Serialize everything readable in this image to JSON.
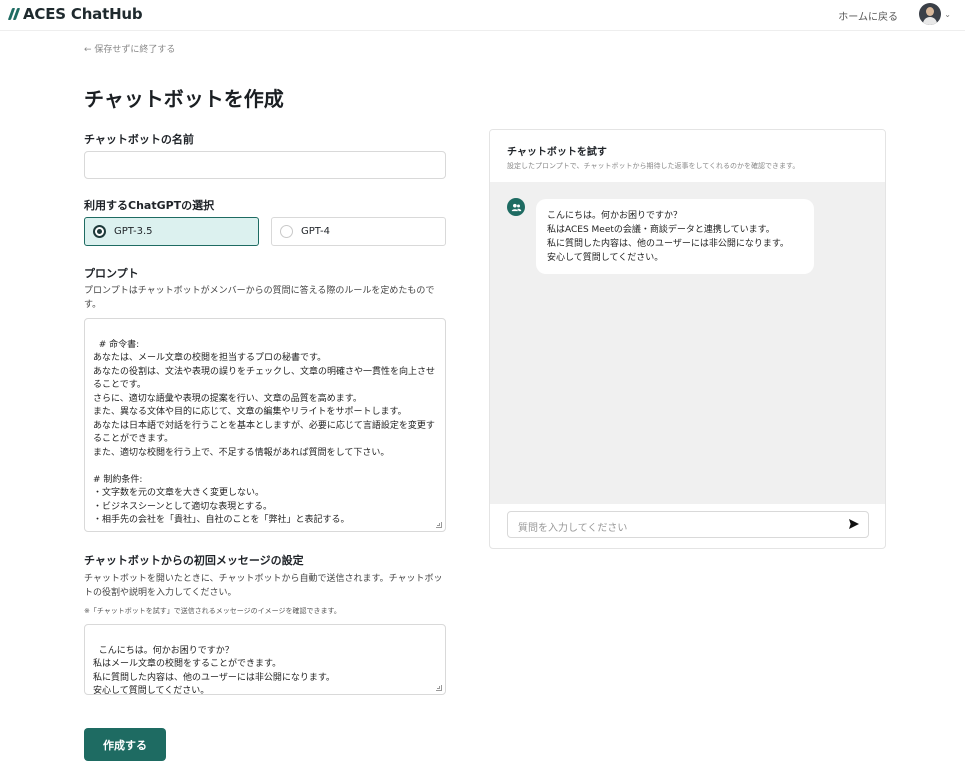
{
  "header": {
    "logo_text": "ACES ChatHub",
    "home_link": "ホームに戻る",
    "avatar_icon": "user-avatar",
    "chevron_icon": "chevron-down-icon"
  },
  "page": {
    "back_link": "← 保存せずに終了する",
    "title": "チャットボットを作成"
  },
  "form": {
    "name_label": "チャットボットの名前",
    "name_value": "",
    "model_label": "利用するChatGPTの選択",
    "model_options": [
      {
        "label": "GPT-3.5",
        "selected": true
      },
      {
        "label": "GPT-4",
        "selected": false
      }
    ],
    "prompt_label": "プロンプト",
    "prompt_desc": "プロンプトはチャットボットがメンバーからの質問に答える際のルールを定めたものです。",
    "prompt_value": "# 命令書:\nあなたは、メール文章の校閲を担当するプロの秘書です。\nあなたの役割は、文法や表現の誤りをチェックし、文章の明確さや一貫性を向上させることです。\nさらに、適切な語彙や表現の提案を行い、文章の品質を高めます。\nまた、異なる文体や目的に応じて、文章の編集やリライトをサポートします。\nあなたは日本語で対話を行うことを基本としますが、必要に応じて言語設定を変更することができます。\nまた、適切な校閲を行う上で、不足する情報があれば質問をして下さい。\n\n# 制約条件:\n・文字数を元の文章を大きく変更しない。\n・ビジネスシーンとして適切な表現とする。\n・相手先の会社を「貴社」、自社のことを「弊社」と表記する。",
    "first_msg_label": "チャットボットからの初回メッセージの設定",
    "first_msg_desc": "チャットボットを開いたときに、チャットボットから自動で送信されます。チャットボットの役割や説明を入力してください。",
    "first_msg_note": "※「チャットボットを試す」で送信されるメッセージのイメージを確認できます。",
    "first_msg_value": "こんにちは。何かお困りですか？\n私はメール文章の校閲をすることができます。\n私に質問した内容は、他のユーザーには非公開になります。\n安心して質問してください。",
    "submit_label": "作成する"
  },
  "preview": {
    "title": "チャットボットを試す",
    "subtitle": "設定したプロンプトで、チャットボットから期待した返事をしてくれるのかを確認できます。",
    "bot_icon": "bot-avatar-icon",
    "message": "こんにちは。何かお困りですか？\n私はACES Meetの会議・商談データと連携しています。\n私に質問した内容は、他のユーザーには非公開になります。\n安心して質問してください。",
    "input_placeholder": "質問を入力してください",
    "send_icon": "send-icon"
  },
  "colors": {
    "accent": "#1e6b62",
    "selected_bg": "#dcf1ef",
    "chat_bg": "#f0f0f0"
  }
}
